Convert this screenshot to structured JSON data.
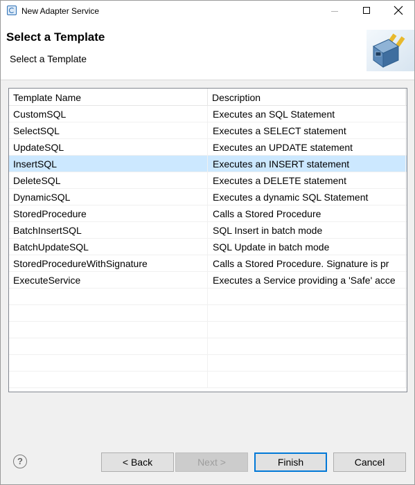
{
  "window": {
    "title": "New Adapter Service"
  },
  "banner": {
    "title": "Select a Template",
    "description": "Select a Template"
  },
  "table": {
    "columns": [
      "Template Name",
      "Description"
    ],
    "selected_index": 3,
    "rows": [
      {
        "name": "CustomSQL",
        "description": "Executes an SQL Statement"
      },
      {
        "name": "SelectSQL",
        "description": "Executes a SELECT statement"
      },
      {
        "name": "UpdateSQL",
        "description": "Executes an UPDATE statement"
      },
      {
        "name": "InsertSQL",
        "description": "Executes an INSERT statement"
      },
      {
        "name": "DeleteSQL",
        "description": "Executes a DELETE statement"
      },
      {
        "name": "DynamicSQL",
        "description": "Executes a dynamic SQL Statement"
      },
      {
        "name": "StoredProcedure",
        "description": "Calls a Stored Procedure"
      },
      {
        "name": "BatchInsertSQL",
        "description": "SQL Insert in batch mode"
      },
      {
        "name": "BatchUpdateSQL",
        "description": "SQL Update in batch mode"
      },
      {
        "name": "StoredProcedureWithSignature",
        "description": "Calls a Stored Procedure. Signature is pr"
      },
      {
        "name": "ExecuteService",
        "description": "Executes a Service providing a 'Safe' acce"
      },
      {
        "name": "",
        "description": ""
      },
      {
        "name": "",
        "description": ""
      },
      {
        "name": "",
        "description": ""
      },
      {
        "name": "",
        "description": ""
      },
      {
        "name": "",
        "description": ""
      },
      {
        "name": "",
        "description": ""
      }
    ]
  },
  "footer": {
    "help_label": "?",
    "back_label": "< Back",
    "next_label": "Next >",
    "finish_label": "Finish",
    "cancel_label": "Cancel"
  },
  "icons": {
    "app": "adapter-app-icon",
    "banner": "adapter-plug-cube-icon",
    "help": "help-icon"
  },
  "colors": {
    "selection": "#cce8ff",
    "default_button_border": "#0078d7"
  }
}
